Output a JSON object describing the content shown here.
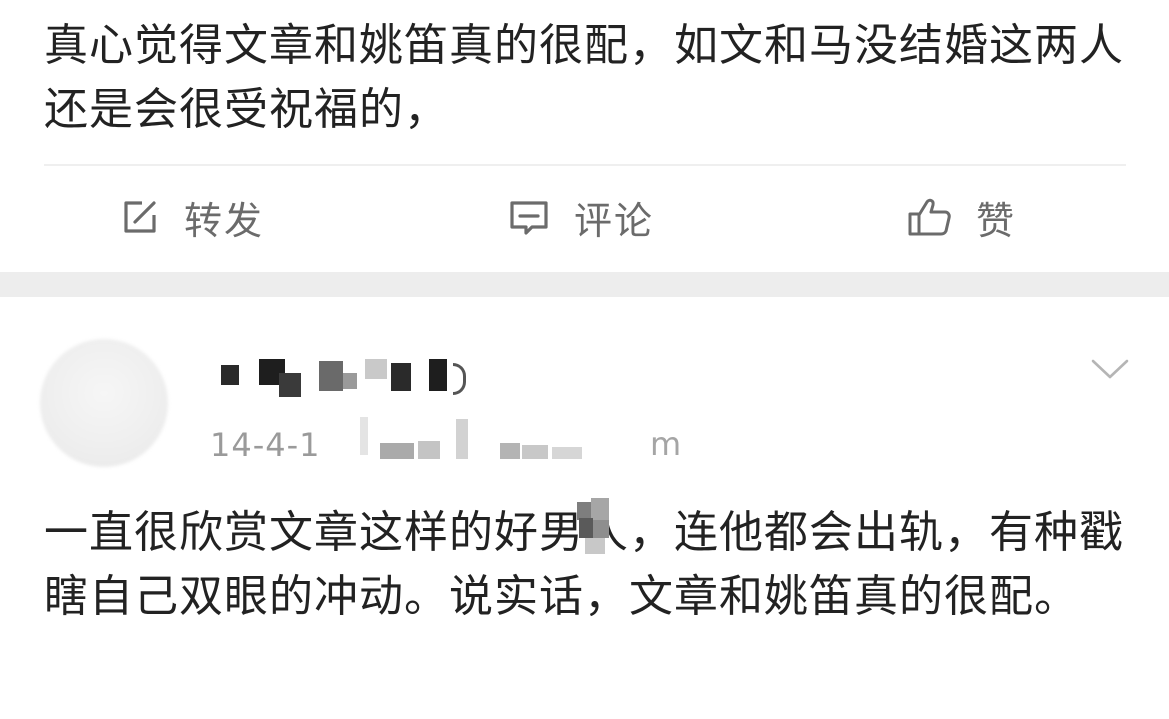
{
  "post1": {
    "text": "真心觉得文章和姚笛真的很配，如文和马没结婚这两人还是会很受祝福的，"
  },
  "actions": {
    "repost": {
      "label": "转发",
      "icon": "edit-square-icon"
    },
    "comment": {
      "label": "评论",
      "icon": "comment-bubble-icon"
    },
    "like": {
      "label": "赞",
      "icon": "thumbs-up-icon"
    }
  },
  "post2": {
    "avatar_icon": "default-avatar-icon",
    "date": "14-4-1",
    "time_suffix": "m",
    "menu_icon": "chevron-down-icon",
    "text": "一直很欣赏文章这样的好男人，连他都会出轨，有种戳瞎自己双眼的冲动。说实话，文章和姚笛真的很配。"
  },
  "colors": {
    "text": "#222222",
    "secondary": "#9a9a9a",
    "action": "#6b6b6b",
    "separator": "#ededed"
  }
}
